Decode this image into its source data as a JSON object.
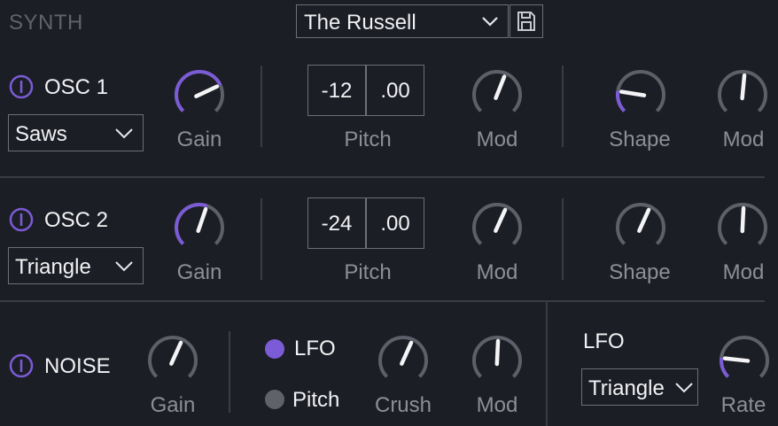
{
  "header": {
    "title": "SYNTH",
    "preset_name": "The Russell"
  },
  "osc1": {
    "label": "OSC 1",
    "wave": "Saws",
    "gain_label": "Gain",
    "pitch_label": "Pitch",
    "pitch_semi": "-12",
    "pitch_fine": ".00",
    "mod1_label": "Mod",
    "shape_label": "Shape",
    "mod2_label": "Mod"
  },
  "osc2": {
    "label": "OSC 2",
    "wave": "Triangle",
    "gain_label": "Gain",
    "pitch_label": "Pitch",
    "pitch_semi": "-24",
    "pitch_fine": ".00",
    "mod1_label": "Mod",
    "shape_label": "Shape",
    "mod2_label": "Mod"
  },
  "noise": {
    "label": "NOISE",
    "gain_label": "Gain",
    "radio_lfo": "LFO",
    "radio_pitch": "Pitch",
    "crush_label": "Crush",
    "mod_label": "Mod"
  },
  "lfo": {
    "label": "LFO",
    "wave": "Triangle",
    "rate_label": "Rate"
  },
  "colors": {
    "accent": "#7b5bd6",
    "knob_track": "#5d6068",
    "background": "#1c1e25",
    "text_dim": "#8c8f96"
  },
  "knob_values": {
    "osc1_gain": 0.74,
    "osc1_mod": 0.58,
    "osc1_shape": 0.2,
    "osc1_mod2": 0.52,
    "osc2_gain": 0.57,
    "osc2_mod": 0.59,
    "osc2_shape": 0.59,
    "osc2_mod2": 0.51,
    "noise_gain": 0.59,
    "noise_crush": 0.59,
    "noise_mod": 0.51,
    "lfo_rate": 0.19
  }
}
